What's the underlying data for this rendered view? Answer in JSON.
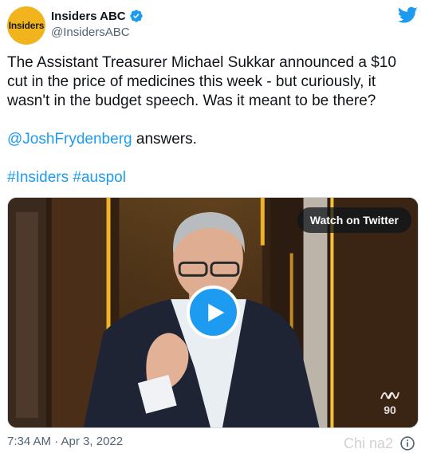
{
  "author": {
    "avatar_text": "Insiders",
    "display_name": "Insiders ABC",
    "handle": "@InsidersABC",
    "verified_icon": "verified-badge-icon"
  },
  "tweet": {
    "text_main": "The Assistant Treasurer Michael Sukkar announced a $10 cut in the price of medicines this week - but curiously, it wasn't in the budget speech. Was it meant to be there?",
    "mention": "@JoshFrydenberg",
    "mention_suffix": " answers.",
    "hashtag_1": "#Insiders",
    "hashtag_2": "#auspol"
  },
  "media": {
    "watch_label": "Watch on Twitter",
    "play_icon": "play-icon",
    "channel_mark": "90"
  },
  "footer": {
    "timestamp": "7:34 AM · Apr 3, 2022",
    "watermark": "Chi na2"
  },
  "colors": {
    "link": "#1d9bf0",
    "avatar_bg": "#f2b41c",
    "text": "#0f1419",
    "muted": "#536471"
  }
}
